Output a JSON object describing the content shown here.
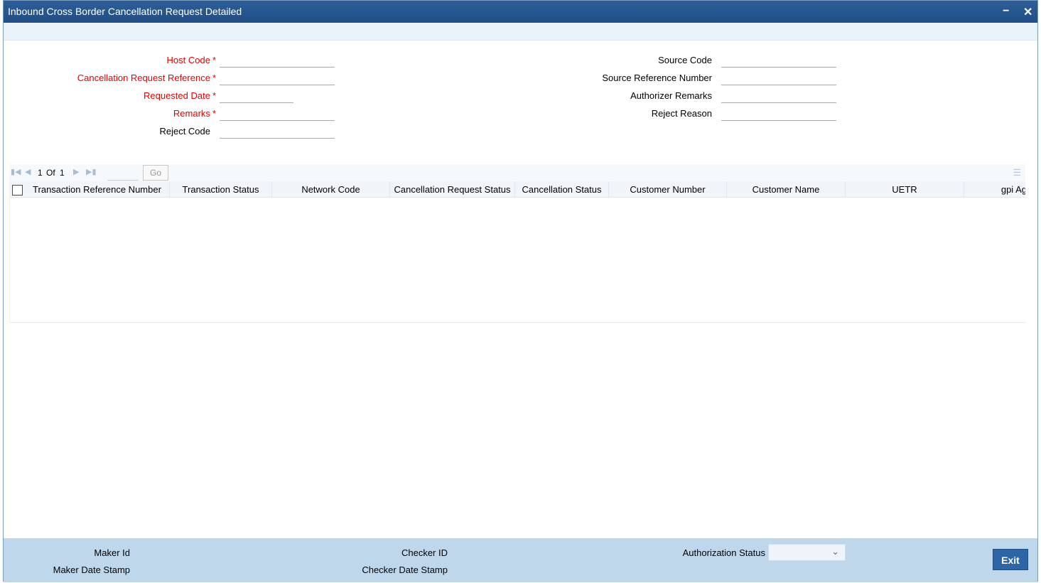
{
  "window": {
    "title": "Inbound Cross Border Cancellation Request Detailed",
    "minimize_label": "−",
    "close_label": "✕"
  },
  "form": {
    "left": [
      {
        "label": "Host Code",
        "required": true,
        "value": ""
      },
      {
        "label": "Cancellation Request Reference",
        "required": true,
        "value": ""
      },
      {
        "label": "Requested Date",
        "required": true,
        "value": ""
      },
      {
        "label": "Remarks",
        "required": true,
        "value": ""
      },
      {
        "label": "Reject Code",
        "required": false,
        "value": ""
      }
    ],
    "right": [
      {
        "label": "Source Code",
        "value": ""
      },
      {
        "label": "Source Reference Number",
        "value": ""
      },
      {
        "label": "Authorizer Remarks",
        "value": ""
      },
      {
        "label": "Reject Reason",
        "value": ""
      }
    ],
    "required_marker": "*"
  },
  "pagination": {
    "current": "1",
    "of_label": "Of",
    "total": "1",
    "go_label": "Go"
  },
  "grid": {
    "columns": [
      "Transaction Reference Number",
      "Transaction Status",
      "Network Code",
      "Cancellation Request Status",
      "Cancellation Status",
      "Customer Number",
      "Customer Name",
      "UETR",
      "gpi Ag"
    ],
    "rows": []
  },
  "footer": {
    "maker_id_label": "Maker Id",
    "maker_date_label": "Maker Date Stamp",
    "checker_id_label": "Checker ID",
    "checker_date_label": "Checker Date Stamp",
    "auth_status_label": "Authorization Status",
    "auth_status_value": "",
    "exit_label": "Exit"
  }
}
